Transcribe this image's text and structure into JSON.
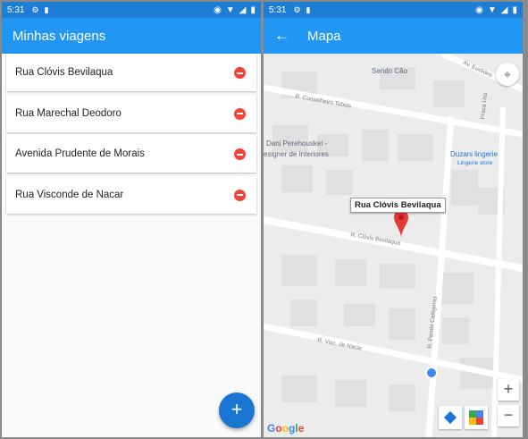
{
  "status": {
    "time": "5:31"
  },
  "left": {
    "title": "Minhas viagens",
    "items": [
      {
        "label": "Rua Clóvis Bevilaqua"
      },
      {
        "label": "Rua Marechal Deodoro"
      },
      {
        "label": "Avenida Prudente de Morais"
      },
      {
        "label": "Rua Visconde de Nacar"
      }
    ],
    "fab_label": "+"
  },
  "right": {
    "title": "Mapa",
    "marker_label": "Rua Clóvis Bevilaqua",
    "pois": {
      "sendo_cao": "Sendo Cão",
      "dani": "Dani Perehouskei -",
      "dani2": "esigner de Interiores",
      "duzani": "Duzani lingerie",
      "duzani2": "Lingerie store"
    },
    "streets": {
      "conselheiro": "R. Conselheiro Tobias",
      "clovis": "R. Clóvis Bevilaqua",
      "nacar": "R. Visc. de Nacar",
      "candido": "R. Parolo Calógeras",
      "euclides": "Av. Euclides",
      "praca": "Praça Uss"
    },
    "zoom_in": "+",
    "zoom_out": "−",
    "google": "Google"
  },
  "colors": {
    "appbar": "#2196f3",
    "statusbar": "#1e7ed6",
    "delete": "#f44336",
    "fab": "#1976d2"
  }
}
